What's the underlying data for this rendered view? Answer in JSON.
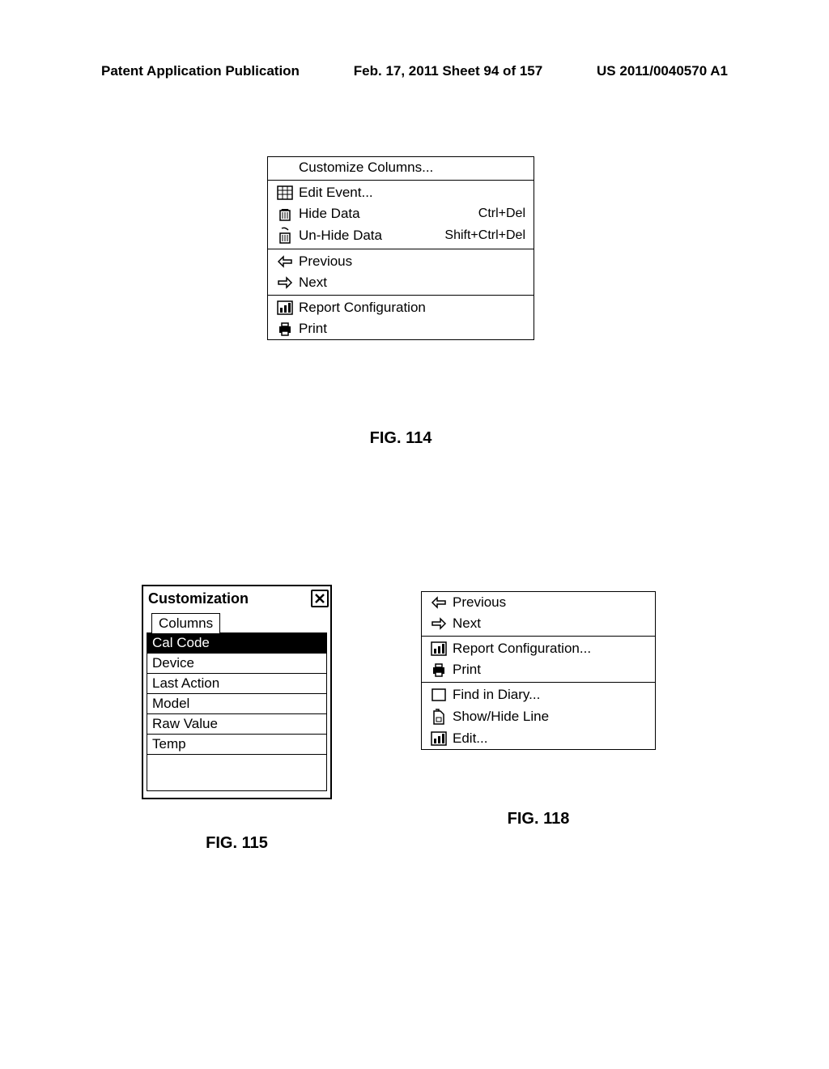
{
  "header": {
    "left": "Patent Application Publication",
    "center": "Feb. 17, 2011  Sheet 94 of 157",
    "right": "US 2011/0040570 A1"
  },
  "fig114": {
    "caption": "FIG. 114",
    "customize": "Customize Columns...",
    "edit_event": "Edit Event...",
    "hide_data": "Hide Data",
    "hide_shortcut": "Ctrl+Del",
    "unhide_data": "Un-Hide Data",
    "unhide_shortcut": "Shift+Ctrl+Del",
    "previous": "Previous",
    "next": "Next",
    "report_config": "Report Configuration",
    "print": "Print"
  },
  "fig115": {
    "caption": "FIG. 115",
    "title": "Customization",
    "tab": "Columns",
    "items": [
      "Cal Code",
      "Device",
      "Last Action",
      "Model",
      "Raw Value",
      "Temp"
    ]
  },
  "fig118": {
    "caption": "FIG. 118",
    "previous": "Previous",
    "next": "Next",
    "report_config": "Report Configuration...",
    "print": "Print",
    "find_diary": "Find in Diary...",
    "show_hide_line": "Show/Hide Line",
    "edit": "Edit..."
  }
}
